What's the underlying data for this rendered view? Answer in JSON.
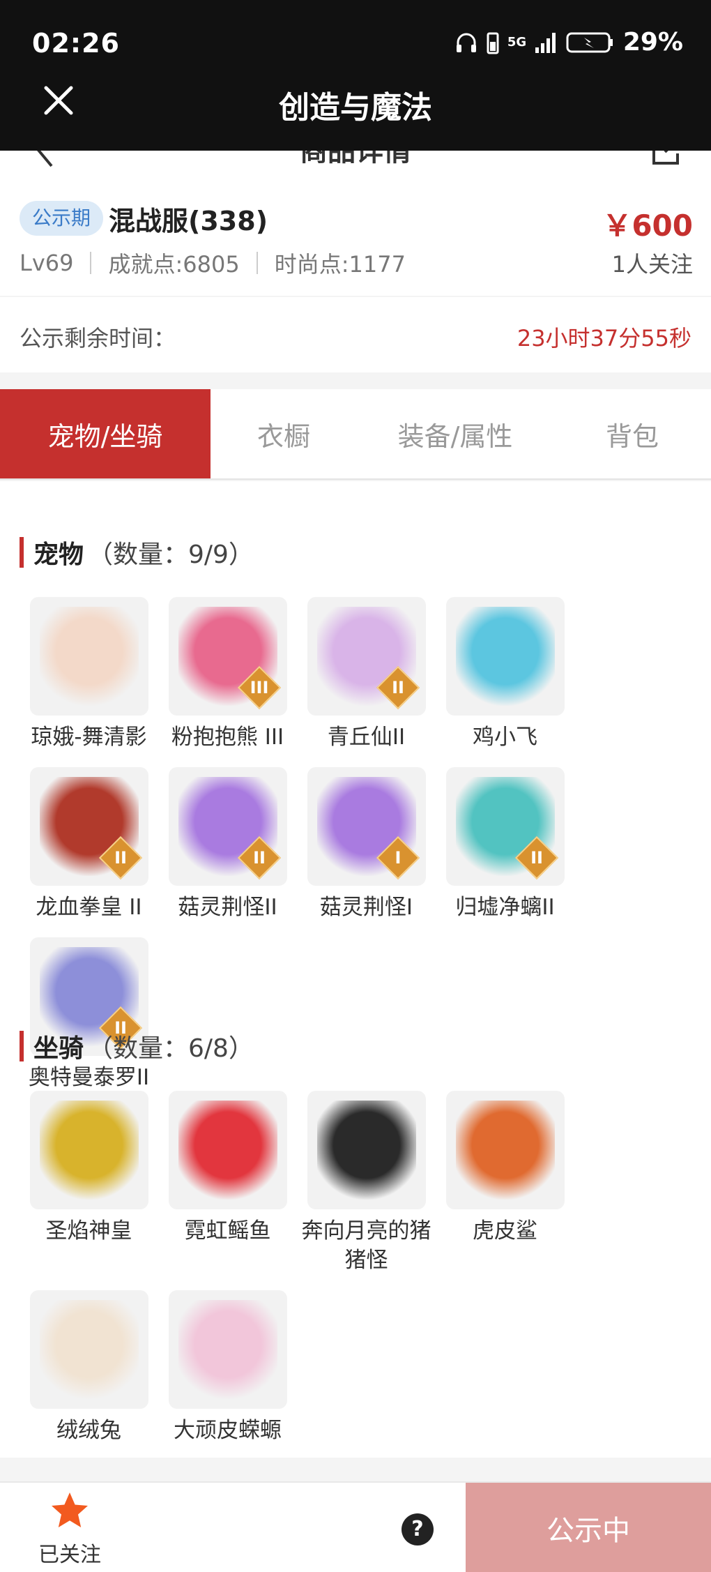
{
  "status_bar": {
    "time": "02:26",
    "battery": "29%",
    "signal": "5G"
  },
  "title_bar": {
    "title": "创造与魔法"
  },
  "sub_header": {
    "title": "商品详情"
  },
  "summary": {
    "badge": "公示期",
    "server": "混战服(338)",
    "price": "￥600",
    "level": "Lv69",
    "achievement": "成就点:6805",
    "fashion": "时尚点:1177",
    "followers": "1人关注"
  },
  "countdown": {
    "label": "公示剩余时间：",
    "value": "23小时37分55秒"
  },
  "tabs": [
    {
      "label": "宠物/坐骑",
      "active": true
    },
    {
      "label": "衣橱",
      "active": false
    },
    {
      "label": "装备/属性",
      "active": false
    },
    {
      "label": "背包",
      "active": false
    }
  ],
  "pets": {
    "title": "宠物",
    "count": "（数量：9/9）",
    "items": [
      {
        "name": "琼娥-舞清影",
        "icon": "pet-avatar",
        "tier": ""
      },
      {
        "name": "粉抱抱熊 III",
        "icon": "pet-avatar",
        "tier": "III"
      },
      {
        "name": "青丘仙II",
        "icon": "pet-avatar",
        "tier": "II"
      },
      {
        "name": "鸡小飞",
        "icon": "pet-avatar",
        "tier": ""
      },
      {
        "name": "龙血拳皇 II",
        "icon": "pet-avatar",
        "tier": "II"
      },
      {
        "name": "菇灵荆怪II",
        "icon": "pet-avatar",
        "tier": "II"
      },
      {
        "name": "菇灵荆怪I",
        "icon": "pet-avatar",
        "tier": "I"
      },
      {
        "name": "归墟净螭II",
        "icon": "pet-avatar",
        "tier": "II"
      },
      {
        "name": "奥特曼泰罗II",
        "icon": "pet-avatar",
        "tier": "II"
      }
    ],
    "colors": [
      "#f3d9c9",
      "#e86a8f",
      "#d9b4e8",
      "#5cc6e0",
      "#b13a2c",
      "#a97be0",
      "#a97be0",
      "#52c3c1",
      "#8d8fd9"
    ]
  },
  "mounts": {
    "title": "坐骑",
    "count": "（数量：6/8）",
    "items": [
      {
        "name": "圣焰神皇",
        "icon": "mount-avatar"
      },
      {
        "name": "霓虹鳐鱼",
        "icon": "mount-avatar"
      },
      {
        "name": "奔向月亮的猪猪怪",
        "icon": "mount-avatar"
      },
      {
        "name": "虎皮鲨",
        "icon": "mount-avatar"
      },
      {
        "name": "绒绒兔",
        "icon": "mount-avatar"
      },
      {
        "name": "大顽皮蝾螈",
        "icon": "mount-avatar"
      }
    ],
    "colors": [
      "#d8b32c",
      "#e2363e",
      "#2a2a2a",
      "#e06a30",
      "#f1e3d2",
      "#f2c6da"
    ]
  },
  "bottom_bar": {
    "follow_label": "已关注",
    "help": "?",
    "action_label": "公示中"
  },
  "colors": {
    "accent": "#c5302e",
    "badge_bg": "#dceaf7",
    "badge_fg": "#3a7bc8",
    "cta_bg": "#de9e9c"
  }
}
